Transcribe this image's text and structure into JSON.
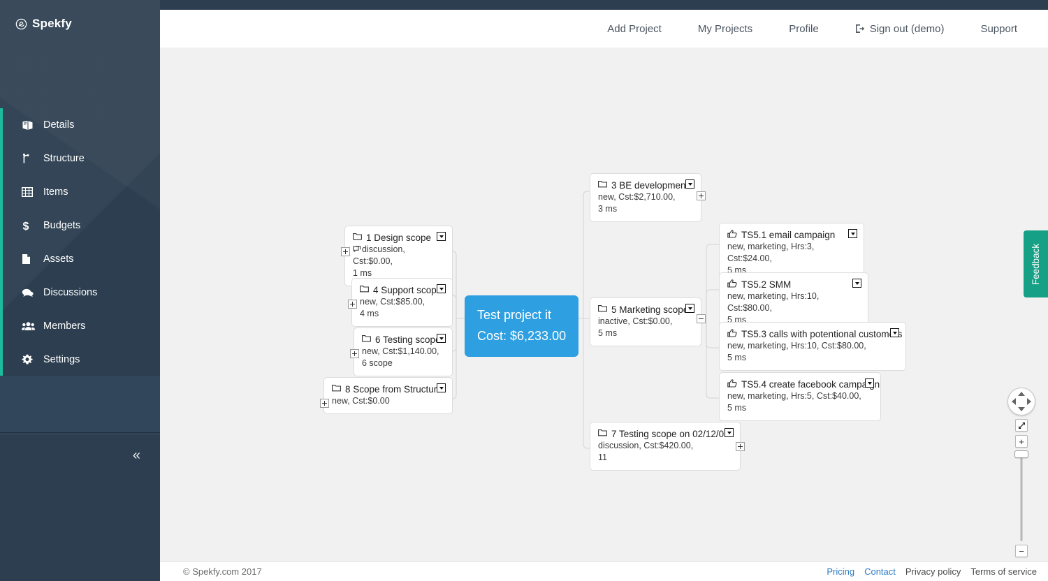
{
  "brand": {
    "name": "Spekfy",
    "logo_icon": "spekfy-circle-logo-icon"
  },
  "sidebar": {
    "items": [
      {
        "label": "Details",
        "icon": "book-icon"
      },
      {
        "label": "Structure",
        "icon": "branch-icon"
      },
      {
        "label": "Items",
        "icon": "table-grid-icon"
      },
      {
        "label": "Budgets",
        "icon": "dollar-sign-icon"
      },
      {
        "label": "Assets",
        "icon": "file-icon"
      },
      {
        "label": "Discussions",
        "icon": "chat-bubbles-icon"
      },
      {
        "label": "Members",
        "icon": "users-group-icon"
      },
      {
        "label": "Settings",
        "icon": "gear-icon"
      }
    ],
    "collapse_glyph": "«",
    "accent_color": "#1abc9c",
    "background_color": "#2c3e50"
  },
  "navbar": {
    "links": [
      {
        "label": "Add Project",
        "icon": ""
      },
      {
        "label": "My Projects",
        "icon": ""
      },
      {
        "label": "Profile",
        "icon": ""
      },
      {
        "label": "Sign out (demo)",
        "icon": "sign-out-icon"
      },
      {
        "label": "Support",
        "icon": ""
      }
    ]
  },
  "mindmap": {
    "root": {
      "title": "Test project it",
      "cost_label": "Cost: $6,233.00",
      "color": "#2e9fe0"
    },
    "left_nodes": [
      {
        "icon": "folder-icon",
        "title": "1 Design scope",
        "meta_icon": "discussion-icon",
        "meta_line1": "discussion, Cst:$0.00,",
        "meta_line2": "1 ms",
        "expander": "+"
      },
      {
        "icon": "folder-icon",
        "title": "4 Support scope",
        "meta_icon": "",
        "meta_line1": "new, Cst:$85.00,",
        "meta_line2": "4 ms",
        "expander": "+"
      },
      {
        "icon": "folder-icon",
        "title": "6 Testing scope",
        "meta_icon": "",
        "meta_line1": "new, Cst:$1,140.00,",
        "meta_line2": "6 scope",
        "expander": "+"
      },
      {
        "icon": "folder-icon",
        "title": "8 Scope from Structure",
        "meta_icon": "",
        "meta_line1": "new, Cst:$0.00",
        "meta_line2": "",
        "expander": "+"
      }
    ],
    "right_nodes": [
      {
        "icon": "folder-icon",
        "title": "3 BE development",
        "meta_line1": "new, Cst:$2,710.00,",
        "meta_line2": "3 ms",
        "expander": "+"
      },
      {
        "icon": "folder-icon",
        "title": "5 Marketing scope",
        "meta_line1": "inactive, Cst:$0.00,",
        "meta_line2": "5 ms",
        "expander": "-"
      },
      {
        "icon": "folder-icon",
        "title": "7 Testing scope on 02/12/07",
        "meta_line1": "discussion, Cst:$420.00,",
        "meta_line2": "11",
        "expander": "+"
      }
    ],
    "task_nodes": [
      {
        "icon": "thumbs-up-icon",
        "title": "TS5.1 email campaign",
        "meta_line1": "new, marketing, Hrs:3, Cst:$24.00,",
        "meta_line2": "5 ms"
      },
      {
        "icon": "thumbs-up-icon",
        "title": "TS5.2 SMM",
        "meta_line1": "new, marketing, Hrs:10, Cst:$80.00,",
        "meta_line2": "5 ms"
      },
      {
        "icon": "thumbs-up-icon",
        "title": "TS5.3 calls with potentional customers",
        "meta_line1": "new, marketing, Hrs:10, Cst:$80.00,",
        "meta_line2": "5 ms"
      },
      {
        "icon": "thumbs-up-icon",
        "title": "TS5.4 create facebook campaign",
        "meta_line1": "new, marketing, Hrs:5, Cst:$40.00,",
        "meta_line2": "5 ms"
      }
    ]
  },
  "map_controls": {
    "pan_icon": "pan-compass-icon",
    "fit_label": "fit-to-screen-icon",
    "zoom_in_label": "+",
    "zoom_out_label": "−"
  },
  "feedback": {
    "label": "Feedback",
    "color": "#16a085"
  },
  "footer": {
    "copyright": "© Spekfy.com 2017",
    "links": [
      {
        "label": "Pricing",
        "style": "blue"
      },
      {
        "label": "Contact",
        "style": "blue"
      },
      {
        "label": "Privacy policy",
        "style": "grey"
      },
      {
        "label": "Terms of service",
        "style": "grey"
      }
    ]
  }
}
